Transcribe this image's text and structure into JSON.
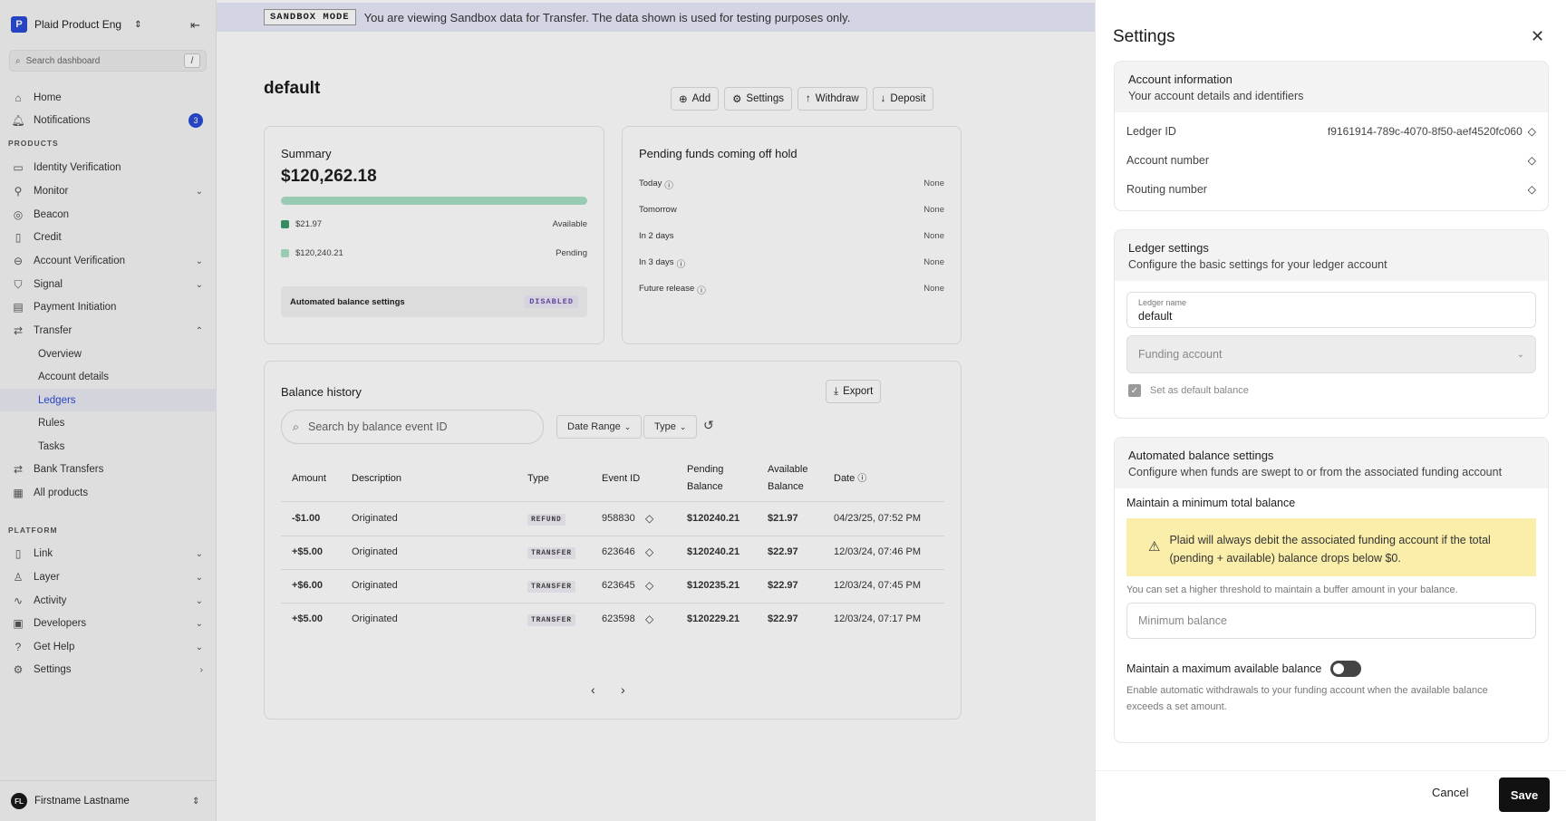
{
  "sidebar": {
    "org_name": "Plaid Product Eng",
    "org_initial": "P",
    "search_placeholder": "Search dashboard",
    "search_shortcut": "/",
    "products_heading": "PRODUCTS",
    "platform_heading": "PLATFORM",
    "items": {
      "home": "Home",
      "notifications": "Notifications",
      "notifications_count": "3",
      "identity_verification": "Identity Verification",
      "monitor": "Monitor",
      "beacon": "Beacon",
      "credit": "Credit",
      "account_verification": "Account Verification",
      "signal": "Signal",
      "payment_initiation": "Payment Initiation",
      "transfer": "Transfer",
      "overview": "Overview",
      "account_details": "Account details",
      "ledgers": "Ledgers",
      "rules": "Rules",
      "tasks": "Tasks",
      "bank_transfers": "Bank Transfers",
      "all_products": "All products",
      "link": "Link",
      "layer": "Layer",
      "activity": "Activity",
      "developers": "Developers",
      "get_help": "Get Help",
      "settings": "Settings"
    },
    "user": {
      "initials": "FL",
      "name": "Firstname Lastname"
    }
  },
  "banner": {
    "tag": "SANDBOX MODE",
    "text": "You are viewing Sandbox data for Transfer. The data shown is used for testing purposes only."
  },
  "main": {
    "title": "default",
    "buttons": {
      "add": "Add",
      "settings": "Settings",
      "withdraw": "Withdraw",
      "deposit": "Deposit"
    },
    "summary": {
      "title": "Summary",
      "total": "$120,262.18",
      "available_fraction": 0.0002,
      "available_amount": "$21.97",
      "available_label": "Available",
      "pending_amount": "$120,240.21",
      "pending_label": "Pending",
      "auto_label": "Automated balance settings",
      "auto_status": "DISABLED",
      "colors": {
        "available": "#3a9a6a",
        "pending": "#a9dfc4"
      }
    },
    "pending": {
      "title": "Pending funds coming off hold",
      "rows": [
        {
          "label": "Today",
          "value": "None",
          "info": true
        },
        {
          "label": "Tomorrow",
          "value": "None",
          "info": false
        },
        {
          "label": "In 2 days",
          "value": "None",
          "info": false
        },
        {
          "label": "In 3 days",
          "value": "None",
          "info": true
        },
        {
          "label": "Future release",
          "value": "None",
          "info": true
        }
      ]
    },
    "history": {
      "title": "Balance history",
      "export": "Export",
      "search_placeholder": "Search by balance event ID",
      "date_range": "Date Range",
      "type_filter": "Type",
      "columns": {
        "amount": "Amount",
        "description": "Description",
        "type": "Type",
        "event_id": "Event ID",
        "pending_1": "Pending",
        "pending_2": "Balance",
        "available_1": "Available",
        "available_2": "Balance",
        "date": "Date"
      },
      "rows": [
        {
          "amount": "-$1.00",
          "description": "Originated",
          "type": "REFUND",
          "event_id": "958830",
          "pending": "$120240.21",
          "available": "$21.97",
          "date": "04/23/25, 07:52 PM"
        },
        {
          "amount": "+$5.00",
          "description": "Originated",
          "type": "TRANSFER",
          "event_id": "623646",
          "pending": "$120240.21",
          "available": "$22.97",
          "date": "12/03/24, 07:46 PM"
        },
        {
          "amount": "+$6.00",
          "description": "Originated",
          "type": "TRANSFER",
          "event_id": "623645",
          "pending": "$120235.21",
          "available": "$22.97",
          "date": "12/03/24, 07:45 PM"
        },
        {
          "amount": "+$5.00",
          "description": "Originated",
          "type": "TRANSFER",
          "event_id": "623598",
          "pending": "$120229.21",
          "available": "$22.97",
          "date": "12/03/24, 07:17 PM"
        }
      ]
    }
  },
  "panel": {
    "title": "Settings",
    "account": {
      "title": "Account information",
      "subtitle": "Your account details and identifiers",
      "ledger_id_label": "Ledger ID",
      "ledger_id_value": "f9161914-789c-4070-8f50-aef4520fc060",
      "account_number_label": "Account number",
      "routing_number_label": "Routing number"
    },
    "ledger": {
      "title": "Ledger settings",
      "subtitle": "Configure the basic settings for your ledger account",
      "name_label": "Ledger name",
      "name_value": "default",
      "funding_placeholder": "Funding account",
      "default_checkbox": "Set as default balance"
    },
    "automated": {
      "title": "Automated balance settings",
      "subtitle": "Configure when funds are swept to or from the associated funding account",
      "min_title": "Maintain a minimum total balance",
      "warning": "Plaid will always debit the associated funding account if the total (pending + available) balance drops below $0.",
      "min_hint": "You can set a higher threshold to maintain a buffer amount in your balance.",
      "min_placeholder": "Minimum balance",
      "max_title": "Maintain a maximum available balance",
      "max_hint": "Enable automatic withdrawals to your funding account when the available balance exceeds a set amount."
    },
    "cancel": "Cancel",
    "save": "Save"
  }
}
